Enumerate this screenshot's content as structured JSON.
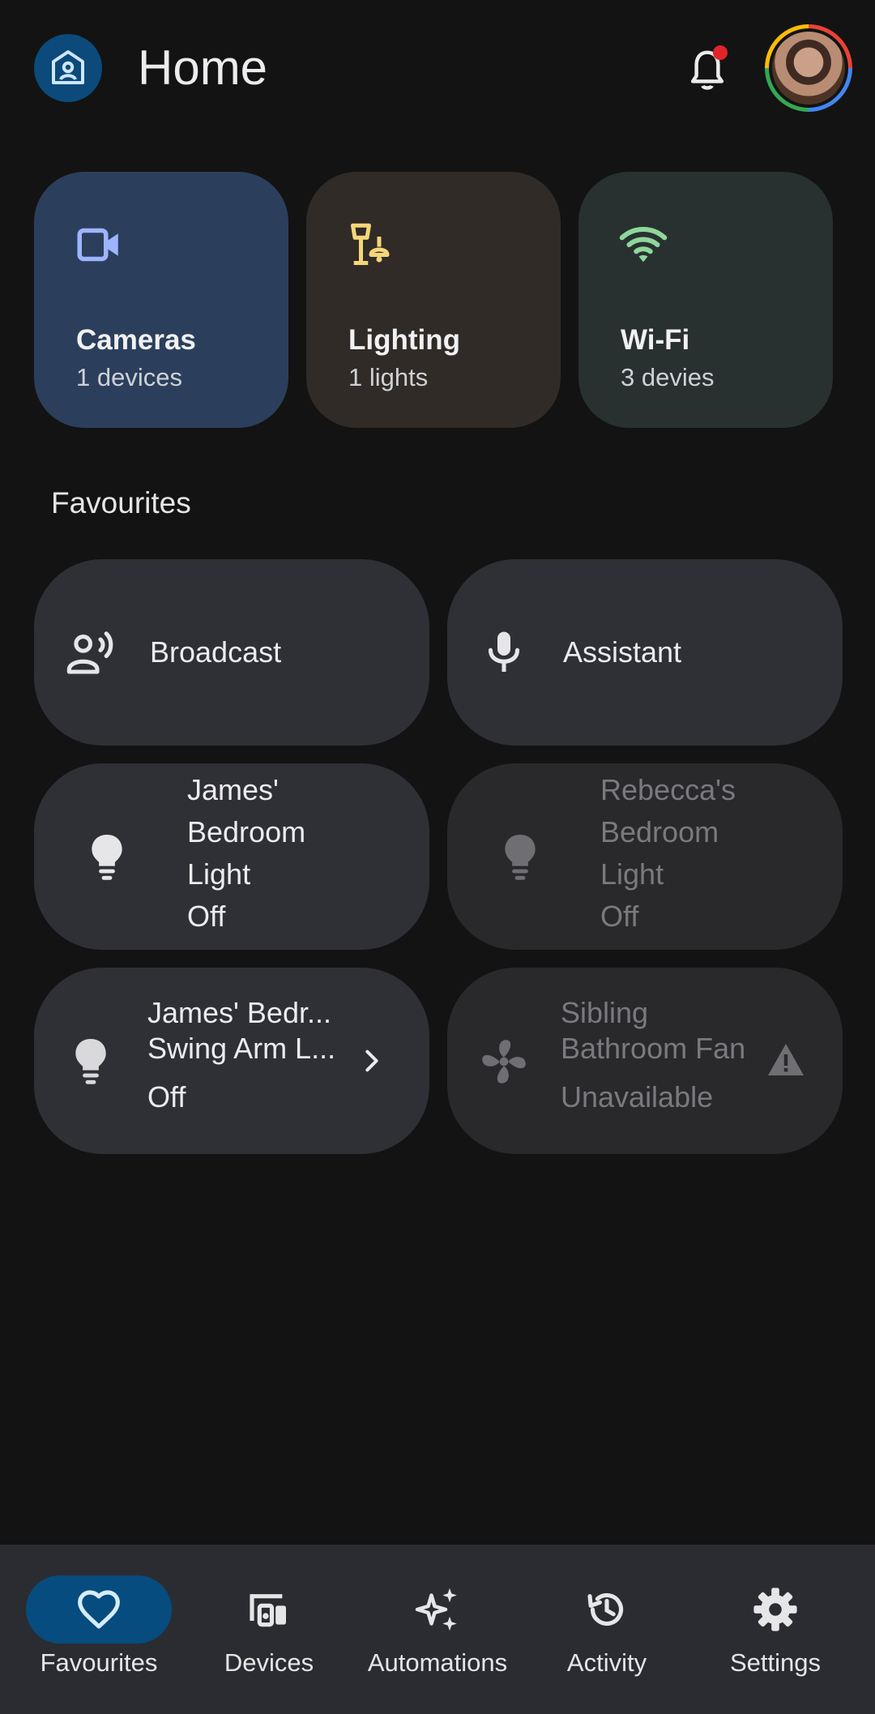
{
  "header": {
    "title": "Home",
    "notification_dot": true
  },
  "categories": [
    {
      "title": "Cameras",
      "subtitle": "1 devices",
      "icon": "video-camera-icon",
      "color": "#2b3f5c",
      "icon_color": "#9fb4ff"
    },
    {
      "title": "Lighting",
      "subtitle": "1 lights",
      "icon": "lamp-icon",
      "color": "#302b27",
      "icon_color": "#f5d77a"
    },
    {
      "title": "Wi-Fi",
      "subtitle": "3 devies",
      "icon": "wifi-icon",
      "color": "#283130",
      "icon_color": "#8fd69b"
    }
  ],
  "favourites": {
    "title": "Favourites",
    "tiles": {
      "broadcast": {
        "label": "Broadcast",
        "icon": "broadcast-icon"
      },
      "assistant": {
        "label": "Assistant",
        "icon": "microphone-icon"
      },
      "james_light": {
        "name_lines": [
          "James'",
          "Bedroom",
          "Light"
        ],
        "status": "Off",
        "icon": "bulb-icon"
      },
      "rebecca_light": {
        "name_lines": [
          "Rebecca's",
          "Bedroom",
          "Light"
        ],
        "status": "Off",
        "icon": "bulb-icon"
      },
      "swing_arm": {
        "name_lines": [
          "James' Bedr...",
          "Swing Arm L..."
        ],
        "status": "Off",
        "icon": "bulb-icon"
      },
      "fan": {
        "name_lines": [
          "Sibling",
          "Bathroom Fan"
        ],
        "status": "Unavailable",
        "icon": "fan-icon"
      }
    }
  },
  "nav": {
    "items": [
      {
        "label": "Favourites",
        "icon": "heart-icon",
        "active": true
      },
      {
        "label": "Devices",
        "icon": "devices-icon",
        "active": false
      },
      {
        "label": "Automations",
        "icon": "sparkle-icon",
        "active": false
      },
      {
        "label": "Activity",
        "icon": "history-icon",
        "active": false
      },
      {
        "label": "Settings",
        "icon": "gear-icon",
        "active": false
      }
    ]
  }
}
